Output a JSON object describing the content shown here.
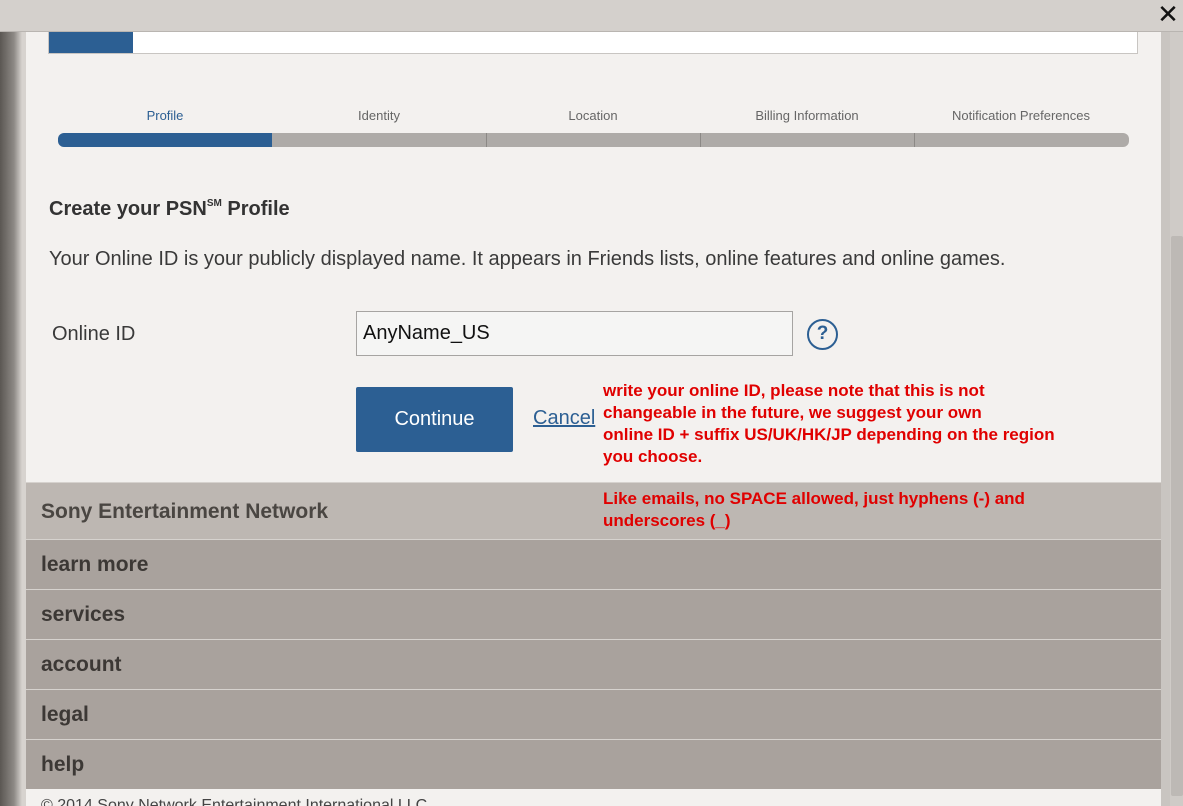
{
  "window": {
    "close_glyph": "✕"
  },
  "steps": [
    "Profile",
    "Identity",
    "Location",
    "Billing Information",
    "Notification Preferences"
  ],
  "form": {
    "heading_main": "Create your PSN",
    "heading_sup": "SM",
    "heading_end": " Profile",
    "intro": "Your Online ID is your publicly displayed name. It appears in Friends lists, online features and online games.",
    "online_id_label": "Online ID",
    "online_id_value": "AnyName_US",
    "help_glyph": "?",
    "continue_label": "Continue",
    "cancel_label": "Cancel"
  },
  "annotations": {
    "note1": [
      "write your online ID, please note that this is not",
      "changeable in the future, we suggest your own",
      "online ID + suffix US/UK/HK/JP depending on the region",
      "you choose."
    ],
    "note2": [
      "Like emails, no SPACE allowed, just hyphens (-) and",
      "underscores (_)"
    ],
    "color": "#e00000"
  },
  "footer": {
    "brand": "Sony Entertainment Network",
    "links": [
      "learn more",
      "services",
      "account",
      "legal",
      "help"
    ],
    "copyright": "© 2014 Sony Network Entertainment International LLC"
  },
  "colors": {
    "accent": "#2c5f93",
    "footer": "#a9a29d"
  }
}
